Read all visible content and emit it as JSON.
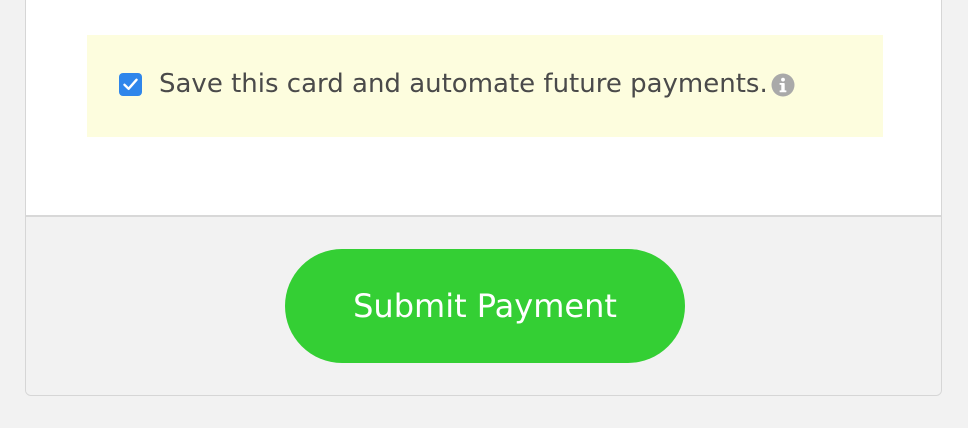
{
  "save_card": {
    "checked": true,
    "label": "Save this card and automate future payments.",
    "info_icon": "info-circle-icon",
    "background_color": "#fdfdde",
    "checkbox_color": "#2f86eb"
  },
  "footer": {
    "submit_label": "Submit Payment",
    "button_color": "#34cf34"
  }
}
